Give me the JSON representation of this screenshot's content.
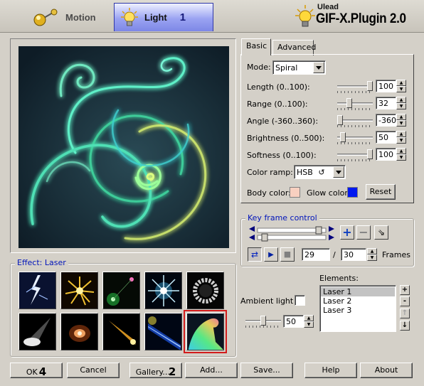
{
  "header": {
    "tabs": [
      {
        "label": "Motion",
        "icon": "motion-sphere-icon"
      },
      {
        "label": "Light",
        "badge": "1",
        "icon": "light-bulb-icon"
      }
    ],
    "brand_small": "Ulead",
    "brand_product": "GIF-X.Plugin 2.0"
  },
  "effect": {
    "group_label": "Effect: Laser",
    "thumbnails": [
      {
        "name": "lightning"
      },
      {
        "name": "fireworks"
      },
      {
        "name": "lens-flare"
      },
      {
        "name": "starburst"
      },
      {
        "name": "ring-glow"
      },
      {
        "name": "spotlight"
      },
      {
        "name": "orange-glow"
      },
      {
        "name": "comet"
      },
      {
        "name": "blue-beam"
      },
      {
        "name": "spiral-laser",
        "selected": true
      }
    ]
  },
  "panel": {
    "tabs": [
      "Basic",
      "Advanced"
    ],
    "active_tab": "Basic",
    "mode_label": "Mode:",
    "mode_value": "Spiral",
    "params": [
      {
        "label": "Length (0..100):",
        "value": "100",
        "level": 1.0
      },
      {
        "label": "Range (0..100):",
        "value": "32",
        "level": 0.32
      },
      {
        "label": "Angle (-360..360):",
        "value": "-360",
        "level": 0.0
      },
      {
        "label": "Brightness (0..500):",
        "value": "50",
        "level": 0.1
      },
      {
        "label": "Softness (0..100):",
        "value": "100",
        "level": 1.0
      }
    ],
    "color_ramp_label": "Color ramp:",
    "color_ramp_value": "HSB",
    "body_color_label": "Body color:",
    "body_color": "#f8d0c0",
    "glow_color_label": "Glow color:",
    "glow_color": "#0018f0",
    "reset_label": "Reset"
  },
  "keyframe": {
    "group_label": "Key frame control",
    "current_frame": "29",
    "separator": "/",
    "total_frames": "30",
    "frames_label": "Frames"
  },
  "ambient": {
    "label": "Ambient light",
    "value": "50",
    "level": 0.5
  },
  "elements": {
    "label": "Elements:",
    "items": [
      "Laser 1",
      "Laser 2",
      "Laser 3"
    ],
    "selected": "Laser 1",
    "buttons": [
      "+",
      "-",
      "↑",
      "↓"
    ]
  },
  "footer": {
    "ok_label": "OK",
    "ok_badge": "4",
    "cancel_label": "Cancel",
    "gallery_label": "Gallery...",
    "gallery_badge": "2",
    "add_label": "Add...",
    "save_label": "Save...",
    "help_label": "Help",
    "about_label": "About"
  }
}
